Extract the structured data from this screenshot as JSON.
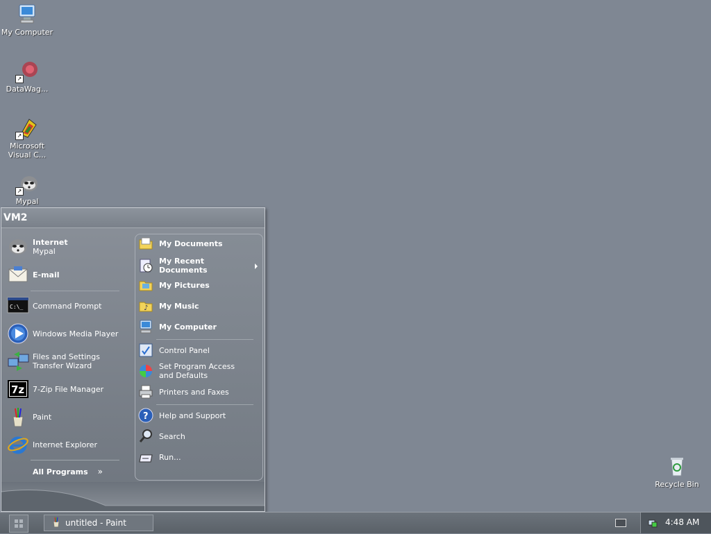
{
  "desktop": {
    "icons": [
      {
        "label": "My Computer",
        "icon": "computer-icon"
      },
      {
        "label": "DataWag...",
        "icon": "datawag-icon"
      },
      {
        "label": "Microsoft Visual C...",
        "icon": "visual-c-icon"
      },
      {
        "label": "Mypal",
        "icon": "mypal-icon"
      },
      {
        "label": "Recycle Bin",
        "icon": "recycle-bin-icon"
      }
    ]
  },
  "start_menu": {
    "user": "VM2",
    "pinned": [
      {
        "title": "Internet",
        "subtitle": "Mypal",
        "icon": "mypal-icon"
      },
      {
        "title": "E-mail",
        "icon": "email-icon"
      }
    ],
    "recent": [
      {
        "label": "Command Prompt",
        "icon": "command-prompt-icon"
      },
      {
        "label": "Windows Media Player",
        "icon": "media-player-icon"
      },
      {
        "label": "Files and Settings Transfer Wizard",
        "icon": "transfer-wizard-icon"
      },
      {
        "label": "7-Zip File Manager",
        "icon": "7zip-icon"
      },
      {
        "label": "Paint",
        "icon": "paint-icon"
      },
      {
        "label": "Internet Explorer",
        "icon": "ie-icon"
      }
    ],
    "all_programs": "All Programs",
    "places": [
      {
        "label": "My Documents",
        "icon": "folder-icon"
      },
      {
        "label": "My Recent Documents",
        "icon": "recent-documents-icon"
      },
      {
        "label": "My Pictures",
        "icon": "folder-icon"
      },
      {
        "label": "My Music",
        "icon": "folder-icon"
      },
      {
        "label": "My Computer",
        "icon": "computer-icon"
      }
    ],
    "settings": [
      {
        "label": "Control Panel",
        "icon": "control-panel-icon"
      },
      {
        "label": "Set Program Access and Defaults",
        "icon": "program-access-icon"
      },
      {
        "label": "Printers and Faxes",
        "icon": "printer-icon"
      }
    ],
    "help": [
      {
        "label": "Help and Support",
        "icon": "help-icon"
      },
      {
        "label": "Search",
        "icon": "search-icon"
      },
      {
        "label": "Run...",
        "icon": "run-icon"
      }
    ]
  },
  "taskbar": {
    "task": "untitled - Paint",
    "clock": "4:48 AM"
  }
}
